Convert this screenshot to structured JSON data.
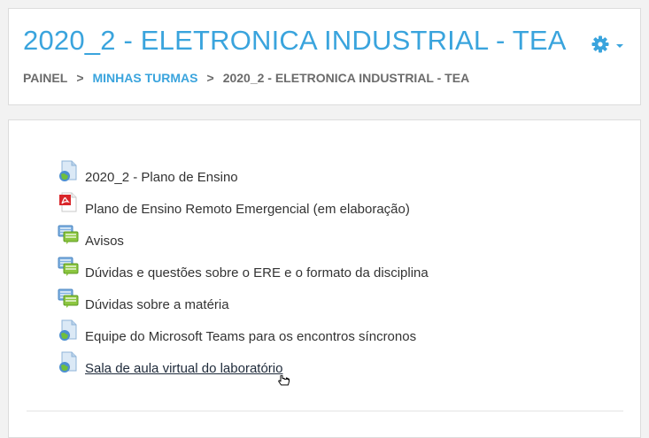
{
  "header": {
    "title": "2020_2 - ELETRONICA INDUSTRIAL - TEA",
    "settings_icon": "gear-icon",
    "accent_color": "#3aa4dd"
  },
  "breadcrumb": {
    "items": [
      {
        "label": "PAINEL"
      },
      {
        "label": "MINHAS TURMAS"
      },
      {
        "label": "2020_2 - ELETRONICA INDUSTRIAL - TEA"
      }
    ],
    "separator": ">"
  },
  "activities": [
    {
      "label": "2020_2 - Plano de Ensino",
      "icon": "url-globe-icon"
    },
    {
      "label": "Plano de Ensino Remoto Emergencial (em elaboração)",
      "icon": "pdf-icon"
    },
    {
      "label": "Avisos",
      "icon": "forum-icon"
    },
    {
      "label": "Dúvidas e questões sobre o ERE e o formato da disciplina",
      "icon": "forum-icon"
    },
    {
      "label": "Dúvidas sobre a matéria",
      "icon": "forum-icon"
    },
    {
      "label": "Equipe do Microsoft Teams para os encontros síncronos",
      "icon": "url-globe-icon"
    },
    {
      "label": "Sala de aula virtual do laboratório",
      "icon": "url-globe-icon"
    }
  ]
}
